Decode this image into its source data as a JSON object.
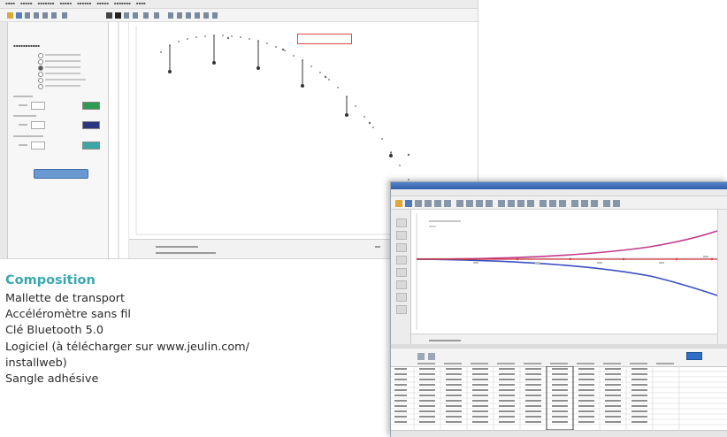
{
  "composition": {
    "title": "Composition",
    "items": [
      "Mallette de transport",
      "Accéléromètre sans fil",
      "Clé Bluetooth 5.0",
      "Logiciel (à télécharger sur www.jeulin.com/",
      "installweb)",
      "Sangle adhésive"
    ]
  },
  "screenshot_1": {
    "accent_colors": {
      "annotation_border": "#d24a4a",
      "swatch_green": "#2f9a52",
      "swatch_navy": "#2c3580",
      "swatch_teal": "#3aa6a6",
      "action_button": "#6a98d0"
    }
  },
  "screenshot_2": {
    "accent_colors": {
      "curve_pink": "#c23b8c",
      "curve_blue": "#3a4fc0",
      "curve_red": "#d23a3a",
      "title_bar": "#2f5ea8",
      "toggle": "#2f6fc8"
    }
  }
}
